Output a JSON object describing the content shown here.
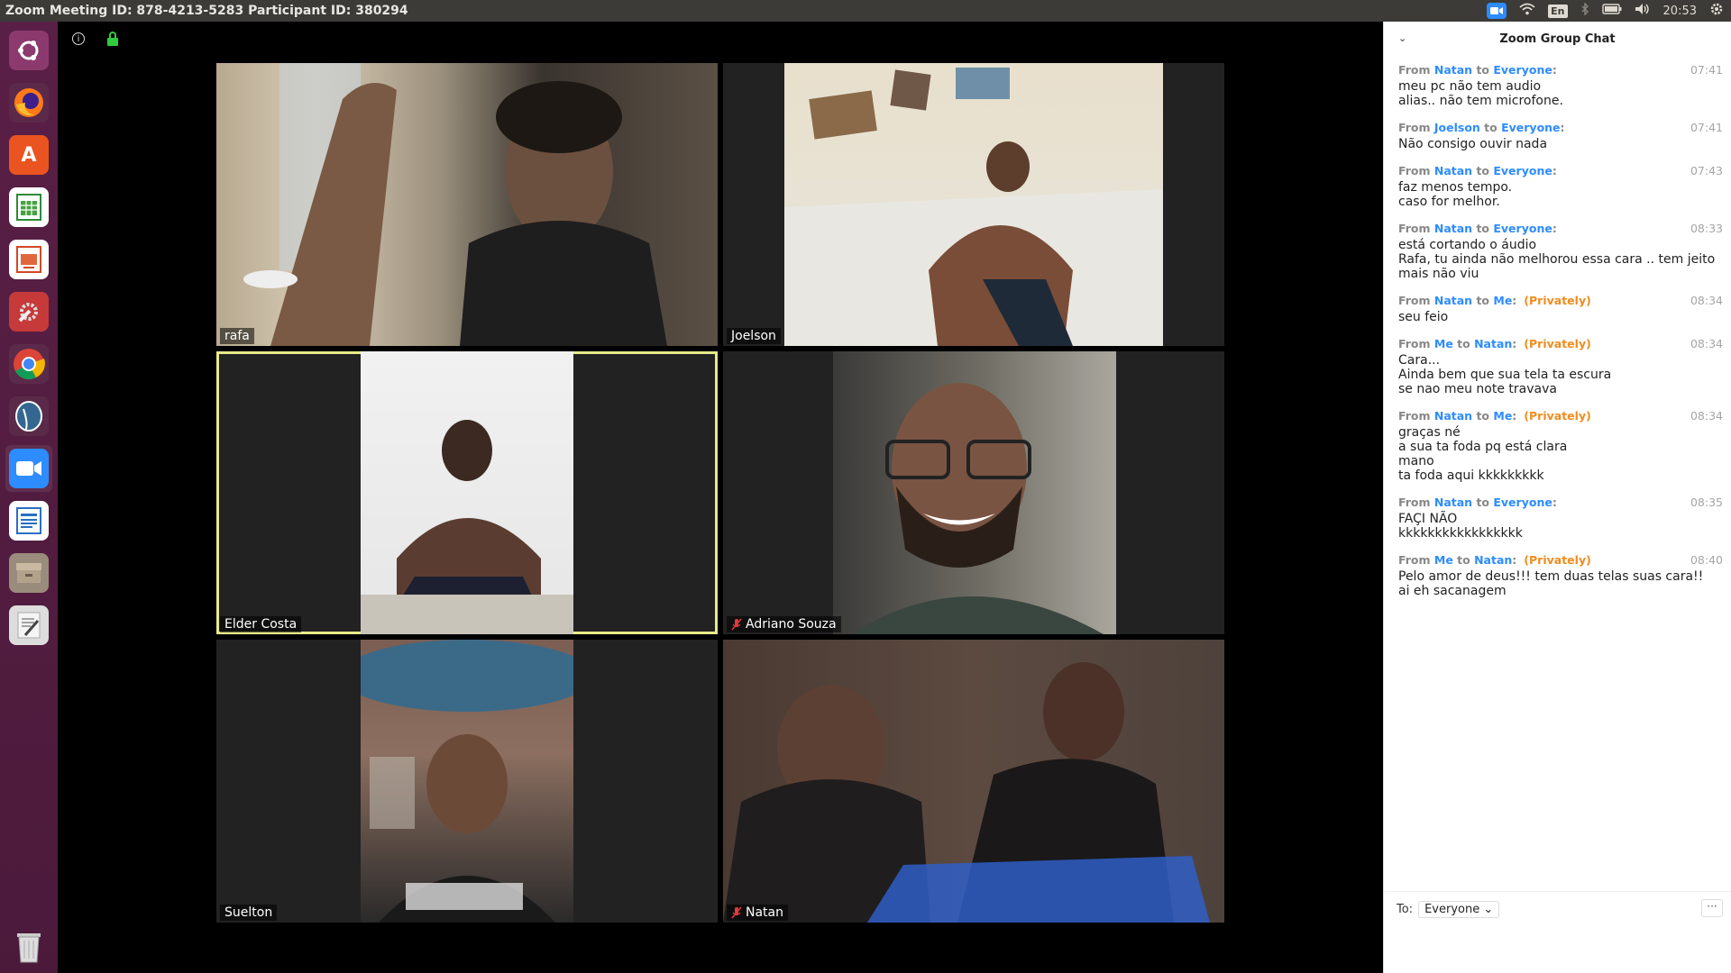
{
  "topbar": {
    "title": "Zoom Meeting ID: 878-4213-5283 Participant ID: 380294",
    "lang": "En",
    "time": "20:53"
  },
  "launcher": [
    "ubuntu-icon",
    "firefox-icon",
    "software-center-icon",
    "spreadsheet-icon",
    "presentation-icon",
    "system-settings-icon",
    "chrome-icon",
    "pgadmin-icon",
    "zoom-icon",
    "writer-icon",
    "archive-icon",
    "text-editor-icon",
    "trash-icon"
  ],
  "tiles": [
    {
      "name": "rafa",
      "muted": false
    },
    {
      "name": "Joelson",
      "muted": false
    },
    {
      "name": "Elder Costa",
      "muted": false,
      "active": true
    },
    {
      "name": "Adriano Souza",
      "muted": true
    },
    {
      "name": "Suelton",
      "muted": false
    },
    {
      "name": "Natan",
      "muted": true
    }
  ],
  "chat": {
    "title": "Zoom Group Chat",
    "to_label": "To:",
    "to_value": "Everyone",
    "more": "···",
    "messages": [
      {
        "from": "Natan",
        "to": "Everyone",
        "private": "",
        "time": "07:41",
        "lines": [
          "meu pc não tem audio",
          "alias.. não tem microfone."
        ]
      },
      {
        "from": "Joelson",
        "to": "Everyone",
        "private": "",
        "time": "07:41",
        "lines": [
          "Não consigo ouvir nada"
        ]
      },
      {
        "from": "Natan",
        "to": "Everyone",
        "private": "",
        "time": "07:43",
        "lines": [
          "faz menos tempo.",
          "caso for melhor."
        ]
      },
      {
        "from": "Natan",
        "to": "Everyone",
        "private": "",
        "time": "08:33",
        "lines": [
          "está cortando o áudio",
          "Rafa, tu ainda não melhorou essa cara .. tem jeito",
          "mais não viu"
        ]
      },
      {
        "from": "Natan",
        "to": "Me",
        "private": "(Privately)",
        "time": "08:34",
        "lines": [
          "seu feio"
        ]
      },
      {
        "from": "Me",
        "to": "Natan",
        "private": "(Privately)",
        "time": "08:34",
        "lines": [
          "Cara...",
          "Ainda bem que sua tela ta escura",
          "se nao meu note travava"
        ]
      },
      {
        "from": "Natan",
        "to": "Me",
        "private": "(Privately)",
        "time": "08:34",
        "lines": [
          "graças né",
          "a sua ta foda pq está clara",
          "mano",
          "ta foda aqui kkkkkkkkk"
        ]
      },
      {
        "from": "Natan",
        "to": "Everyone",
        "private": "",
        "time": "08:35",
        "lines": [
          "FAÇI NÃO",
          "kkkkkkkkkkkkkkkkk"
        ]
      },
      {
        "from": "Me",
        "to": "Natan",
        "private": "(Privately)",
        "time": "08:40",
        "lines": [
          "Pelo amor de deus!!! tem duas telas suas cara!!",
          "ai eh sacanagem"
        ]
      }
    ]
  }
}
